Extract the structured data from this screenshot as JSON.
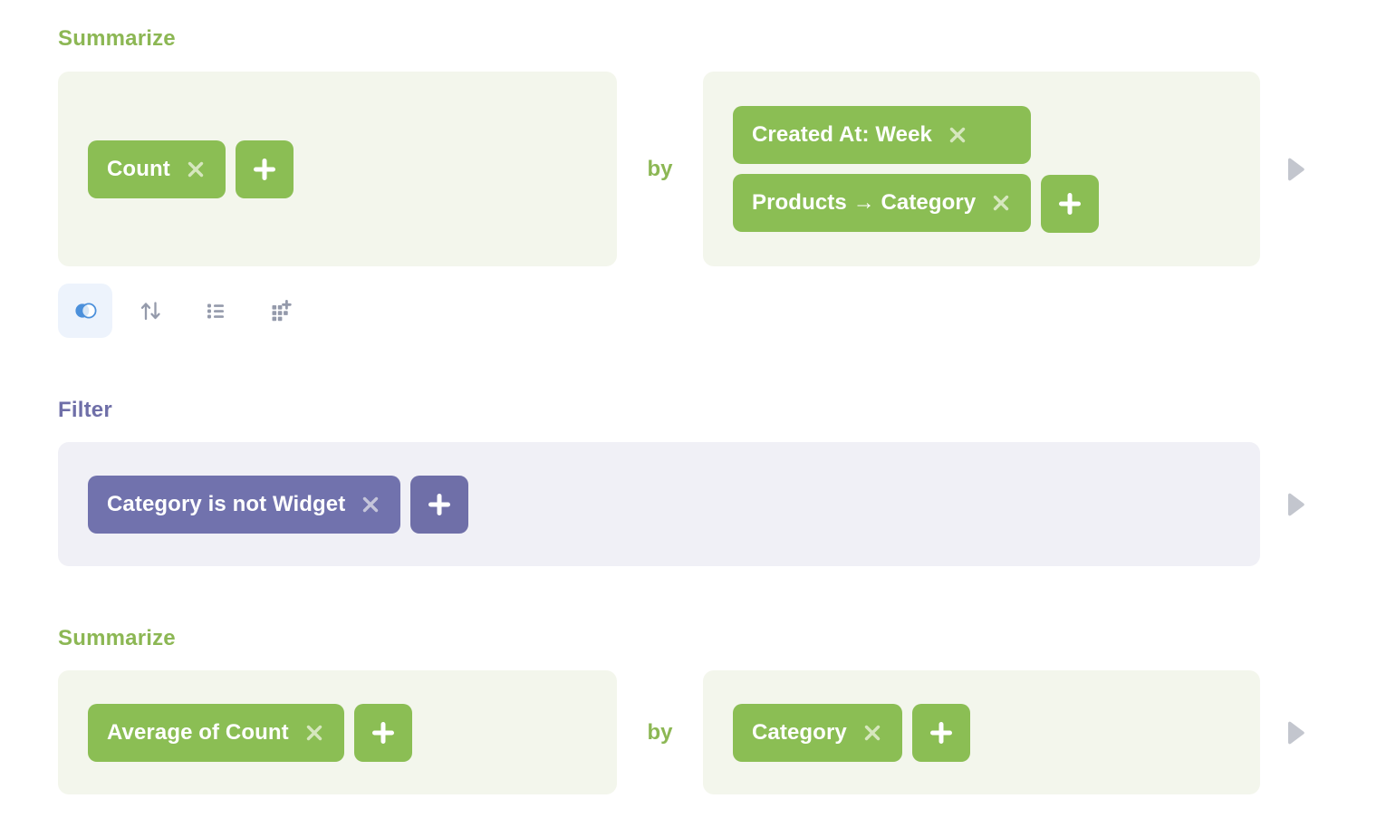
{
  "colors": {
    "summarize_accent": "#8CB754",
    "filter_accent": "#6F6FA8",
    "summarize_pill": "#8BBE54",
    "filter_pill": "#7172AD",
    "summarize_panel": "#F3F6EC",
    "filter_panel": "#F0F0F6",
    "icon_active_bg": "#EDF3FC",
    "icon_active_fg": "#4C90DB",
    "icon_idle_fg": "#949AAB",
    "play_fg": "#C3C6CE"
  },
  "steps": [
    {
      "id": "summarize-1",
      "heading": "Summarize",
      "connector": "by",
      "aggregations": [
        {
          "label": "Count",
          "remove_label": "×"
        }
      ],
      "add_aggregation_label": "+",
      "breakouts": [
        {
          "label": "Created At: Week",
          "remove_label": "×"
        },
        {
          "label": "Products → Category",
          "remove_label": "×"
        }
      ],
      "add_breakout_label": "+",
      "run_label": "▶"
    },
    {
      "id": "filter-1",
      "heading": "Filter",
      "filters": [
        {
          "label": "Category is not Widget",
          "remove_label": "×"
        }
      ],
      "add_filter_label": "+",
      "run_label": "▶"
    },
    {
      "id": "summarize-2",
      "heading": "Summarize",
      "connector": "by",
      "aggregations": [
        {
          "label": "Average of Count",
          "remove_label": "×"
        }
      ],
      "add_aggregation_label": "+",
      "breakouts": [
        {
          "label": "Category",
          "remove_label": "×"
        }
      ],
      "add_breakout_label": "+",
      "run_label": "▶"
    }
  ],
  "step_actions": {
    "items": [
      {
        "icon": "join-data-icon",
        "name": "join-data",
        "active": true
      },
      {
        "icon": "sort-icon",
        "name": "sort",
        "active": false
      },
      {
        "icon": "row-limit-icon",
        "name": "row-limit",
        "active": false
      },
      {
        "icon": "custom-column-icon",
        "name": "custom-column",
        "active": false
      }
    ]
  }
}
